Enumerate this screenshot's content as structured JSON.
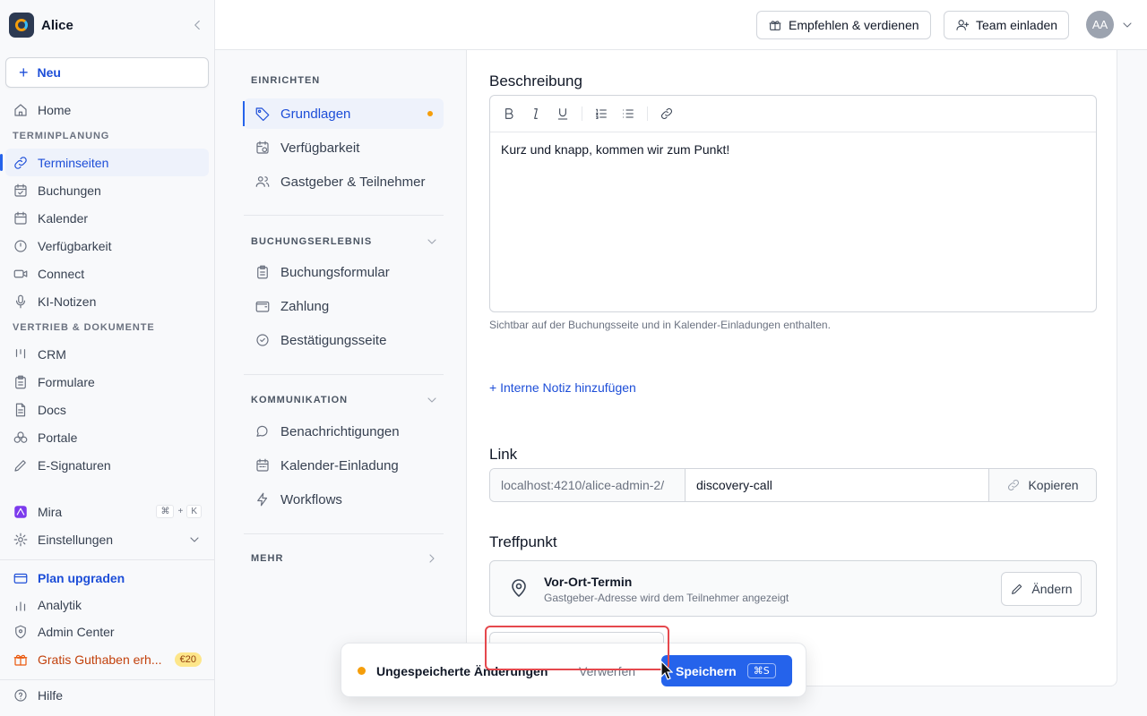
{
  "sidebar": {
    "workspace": "Alice",
    "new_label": "Neu",
    "home": "Home",
    "section_scheduling": "TERMINPLANUNG",
    "scheduling_items": [
      "Terminseiten",
      "Buchungen",
      "Kalender",
      "Verfügbarkeit",
      "Connect",
      "KI-Notizen"
    ],
    "section_sales": "VERTRIEB & DOKUMENTE",
    "sales_items": [
      "CRM",
      "Formulare",
      "Docs",
      "Portale",
      "E-Signaturen"
    ],
    "mira": "Mira",
    "mira_kbd": [
      "⌘",
      "+",
      "K"
    ],
    "settings": "Einstellungen",
    "upgrade": "Plan upgraden",
    "analytics": "Analytik",
    "admin": "Admin Center",
    "credit": "Gratis Guthaben erh...",
    "credit_badge": "€20",
    "help": "Hilfe"
  },
  "topbar": {
    "refer": "Empfehlen & verdienen",
    "invite": "Team einladen",
    "avatar": "AA"
  },
  "settings_nav": {
    "section_setup": "EINRICHTEN",
    "setup_items": [
      "Grundlagen",
      "Verfügbarkeit",
      "Gastgeber & Teilnehmer"
    ],
    "section_booking": "BUCHUNGSERLEBNIS",
    "booking_items": [
      "Buchungsformular",
      "Zahlung",
      "Bestätigungsseite"
    ],
    "section_comm": "KOMMUNIKATION",
    "comm_items": [
      "Benachrichtigungen",
      "Kalender-Einladung",
      "Workflows"
    ],
    "section_more": "MEHR"
  },
  "main": {
    "description_label": "Beschreibung",
    "description_text": "Kurz und knapp, kommen wir zum Punkt!",
    "description_hint": "Sichtbar auf der Buchungsseite und in Kalender-Einladungen enthalten.",
    "add_note": "+ Interne Notiz hinzufügen",
    "link_label": "Link",
    "link_prefix": "localhost:4210/alice-admin-2/",
    "link_slug": "discovery-call",
    "copy": "Kopieren",
    "location_label": "Treffpunkt",
    "location_title": "Vor-Ort-Termin",
    "location_sub": "Gastgeber-Adresse wird dem Teilnehmer angezeigt",
    "change": "Ändern"
  },
  "savebar": {
    "message": "Ungespeicherte Änderungen",
    "discard": "Verwerfen",
    "save": "Speichern",
    "save_kbd": "⌘S"
  },
  "colors": {
    "accent": "#2563eb",
    "unsaved_dot": "#f59e0b",
    "highlight": "#e5484d"
  }
}
